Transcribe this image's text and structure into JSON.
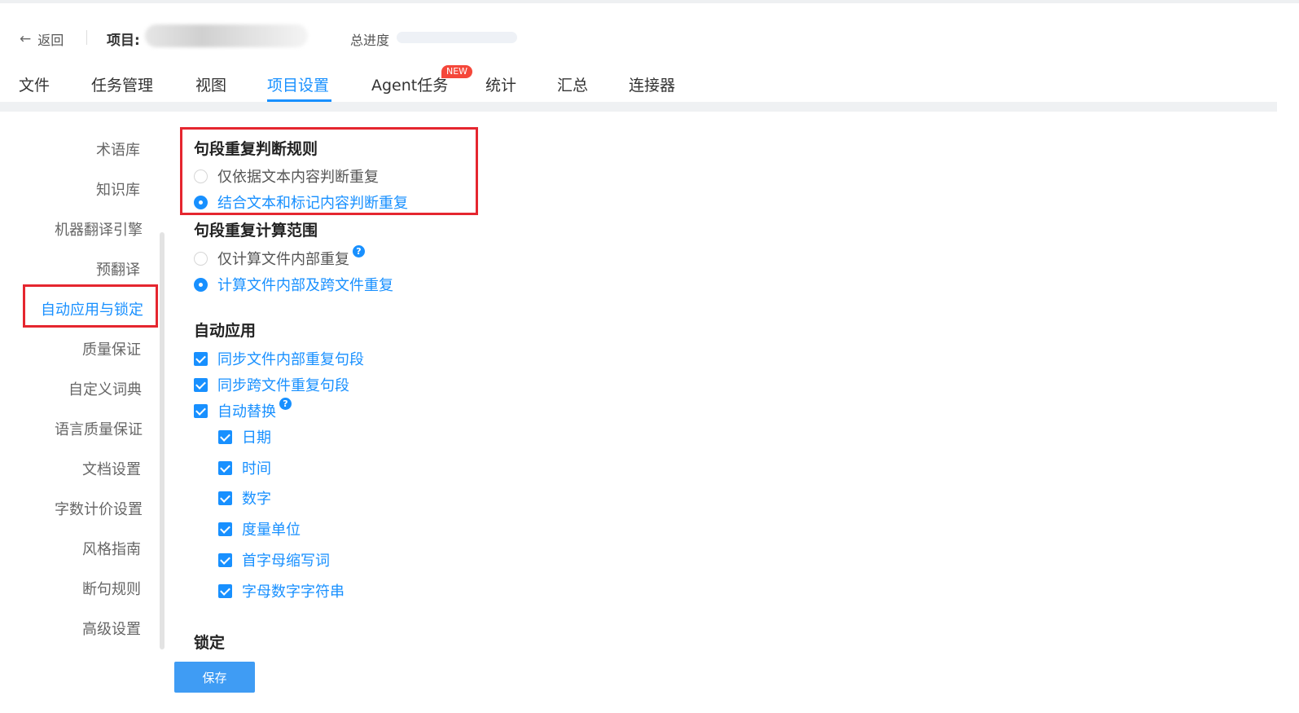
{
  "header": {
    "back_label": "返回",
    "project_label": "项目:",
    "progress_label": "总进度",
    "progress_value": 0
  },
  "tabs": [
    {
      "label": "文件"
    },
    {
      "label": "任务管理"
    },
    {
      "label": "视图"
    },
    {
      "label": "项目设置",
      "active": true
    },
    {
      "label": "Agent任务",
      "badge": "NEW"
    },
    {
      "label": "统计"
    },
    {
      "label": "汇总"
    },
    {
      "label": "连接器"
    }
  ],
  "sidebar": {
    "items": [
      {
        "label": "术语库"
      },
      {
        "label": "知识库"
      },
      {
        "label": "机器翻译引擎"
      },
      {
        "label": "预翻译"
      },
      {
        "label": "自动应用与锁定",
        "active": true
      },
      {
        "label": "质量保证"
      },
      {
        "label": "自定义词典"
      },
      {
        "label": "语言质量保证"
      },
      {
        "label": "文档设置"
      },
      {
        "label": "字数计价设置"
      },
      {
        "label": "风格指南"
      },
      {
        "label": "断句规则"
      },
      {
        "label": "高级设置"
      }
    ]
  },
  "settings": {
    "repeat_rule": {
      "title": "句段重复判断规则",
      "options": [
        {
          "label": "仅依据文本内容判断重复",
          "selected": false
        },
        {
          "label": "结合文本和标记内容判断重复",
          "selected": true
        }
      ]
    },
    "repeat_scope": {
      "title": "句段重复计算范围",
      "options": [
        {
          "label": "仅计算文件内部重复",
          "selected": false,
          "help": "?"
        },
        {
          "label": "计算文件内部及跨文件重复",
          "selected": true
        }
      ]
    },
    "auto_apply": {
      "title": "自动应用",
      "options": [
        {
          "label": "同步文件内部重复句段",
          "checked": true
        },
        {
          "label": "同步跨文件重复句段",
          "checked": true
        },
        {
          "label": "自动替换",
          "checked": true,
          "help": "?"
        }
      ],
      "sub_options": [
        {
          "label": "日期",
          "checked": true
        },
        {
          "label": "时间",
          "checked": true
        },
        {
          "label": "数字",
          "checked": true
        },
        {
          "label": "度量单位",
          "checked": true
        },
        {
          "label": "首字母缩写词",
          "checked": true
        },
        {
          "label": "字母数字字符串",
          "checked": true
        }
      ]
    },
    "lock": {
      "title": "锁定"
    }
  },
  "save_label": "保存",
  "colors": {
    "accent": "#1890ff",
    "highlight_border": "#e5262f",
    "badge": "#f5473a"
  }
}
